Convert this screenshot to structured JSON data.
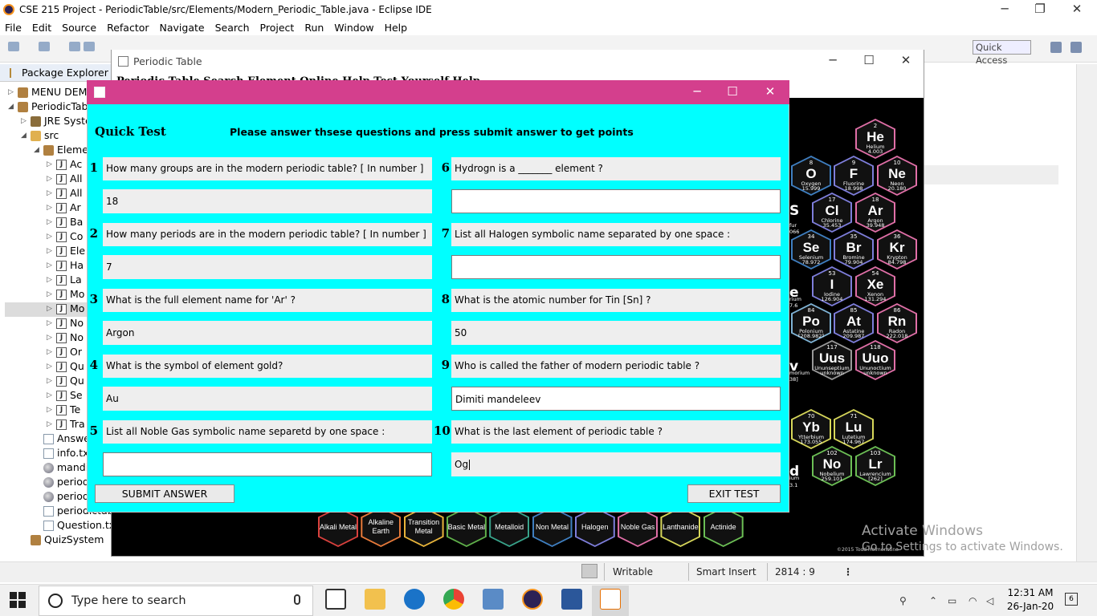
{
  "eclipse": {
    "title": "CSE 215 Project - PeriodicTable/src/Elements/Modern_Periodic_Table.java - Eclipse IDE",
    "menu": [
      "File",
      "Edit",
      "Source",
      "Refactor",
      "Navigate",
      "Search",
      "Project",
      "Run",
      "Window",
      "Help"
    ],
    "quick_access": "Quick Access",
    "package_explorer_tab": "Package Explorer",
    "tree": [
      {
        "label": "MENU DEM",
        "icon": "project-icon",
        "arrow": "▷"
      },
      {
        "label": "PeriodicTab",
        "icon": "project-icon",
        "arrow": "◢"
      },
      {
        "label": "JRE Syste",
        "icon": "library-icon",
        "arrow": "▷"
      },
      {
        "label": "src",
        "icon": "folder-icon",
        "arrow": "◢"
      },
      {
        "label": "Eleme",
        "icon": "package-icon",
        "arrow": "◢"
      },
      {
        "label": "Ac",
        "icon": "java-file-icon",
        "arrow": "▷"
      },
      {
        "label": "All",
        "icon": "java-file-icon",
        "arrow": "▷"
      },
      {
        "label": "All",
        "icon": "java-file-icon",
        "arrow": "▷"
      },
      {
        "label": "Ar",
        "icon": "java-file-icon",
        "arrow": "▷"
      },
      {
        "label": "Ba",
        "icon": "java-file-icon",
        "arrow": "▷"
      },
      {
        "label": "Co",
        "icon": "java-file-icon",
        "arrow": "▷"
      },
      {
        "label": "Ele",
        "icon": "java-file-icon",
        "arrow": "▷"
      },
      {
        "label": "Ha",
        "icon": "java-file-icon",
        "arrow": "▷"
      },
      {
        "label": "La",
        "icon": "java-file-icon",
        "arrow": "▷"
      },
      {
        "label": "Mo",
        "icon": "java-file-icon",
        "arrow": "▷"
      },
      {
        "label": "Mo",
        "icon": "java-file-icon",
        "arrow": "▷"
      },
      {
        "label": "No",
        "icon": "java-file-icon",
        "arrow": "▷"
      },
      {
        "label": "No",
        "icon": "java-file-icon",
        "arrow": "▷"
      },
      {
        "label": "Or",
        "icon": "java-file-icon",
        "arrow": "▷"
      },
      {
        "label": "Qu",
        "icon": "java-file-icon",
        "arrow": "▷"
      },
      {
        "label": "Qu",
        "icon": "java-file-icon",
        "arrow": "▷"
      },
      {
        "label": "Se",
        "icon": "java-file-icon",
        "arrow": "▷"
      },
      {
        "label": "Te",
        "icon": "java-file-icon",
        "arrow": "▷"
      },
      {
        "label": "Tra",
        "icon": "java-file-icon",
        "arrow": "▷"
      },
      {
        "label": "Answers",
        "icon": "text-file-icon",
        "arrow": ""
      },
      {
        "label": "info.txt",
        "icon": "text-file-icon",
        "arrow": ""
      },
      {
        "label": "mandiliv",
        "icon": "image-file-icon",
        "arrow": ""
      },
      {
        "label": "periodic_",
        "icon": "image-file-icon",
        "arrow": ""
      },
      {
        "label": "periodicT",
        "icon": "image-file-icon",
        "arrow": ""
      },
      {
        "label": "periodictable.t",
        "icon": "text-file-icon",
        "arrow": ""
      },
      {
        "label": "Question.txt",
        "icon": "text-file-icon",
        "arrow": ""
      },
      {
        "label": "QuizSystem",
        "icon": "project-icon",
        "arrow": ""
      }
    ],
    "status": {
      "writable": "Writable",
      "insert": "Smart Insert",
      "position": "2814 : 9"
    },
    "activate_line1": "Activate Windows",
    "activate_line2": "Go to Settings to activate Windows."
  },
  "periodic_window": {
    "title": "Periodic Table",
    "menu_text": "Periodic Table  Search Element  Online Help  Test Yourself  Help",
    "copyright": "©2015 Todd Helmenstine",
    "elements": [
      {
        "num": "2",
        "sym": "He",
        "name": "Helium",
        "wt": "4.003",
        "color": "#e06fa7"
      },
      {
        "num": "8",
        "sym": "O",
        "name": "Oxygen",
        "wt": "15.999",
        "color": "#3f7fc1"
      },
      {
        "num": "9",
        "sym": "F",
        "name": "Fluorine",
        "wt": "18.998",
        "color": "#7e7edb"
      },
      {
        "num": "10",
        "sym": "Ne",
        "name": "Neon",
        "wt": "20.180",
        "color": "#e06fa7"
      },
      {
        "num": "17",
        "sym": "Cl",
        "name": "Chlorine",
        "wt": "35.453",
        "color": "#7e7edb"
      },
      {
        "num": "18",
        "sym": "Ar",
        "name": "Argon",
        "wt": "39.948",
        "color": "#e06fa7"
      },
      {
        "num": "34",
        "sym": "Se",
        "name": "Selenium",
        "wt": "78.972",
        "color": "#3f7fc1"
      },
      {
        "num": "35",
        "sym": "Br",
        "name": "Bromine",
        "wt": "79.904",
        "color": "#7e7edb"
      },
      {
        "num": "36",
        "sym": "Kr",
        "name": "Krypton",
        "wt": "84.798",
        "color": "#e06fa7"
      },
      {
        "num": "53",
        "sym": "I",
        "name": "Iodine",
        "wt": "126.904",
        "color": "#7e7edb"
      },
      {
        "num": "54",
        "sym": "Xe",
        "name": "Xenon",
        "wt": "131.294",
        "color": "#e06fa7"
      },
      {
        "num": "84",
        "sym": "Po",
        "name": "Polonium",
        "wt": "[208.982]",
        "color": "#7fb3d5"
      },
      {
        "num": "85",
        "sym": "At",
        "name": "Astatine",
        "wt": "209.987",
        "color": "#7e7edb"
      },
      {
        "num": "86",
        "sym": "Rn",
        "name": "Radon",
        "wt": "222.018",
        "color": "#e06fa7"
      },
      {
        "num": "117",
        "sym": "Uus",
        "name": "Ununseptium",
        "wt": "unknown",
        "color": "#999999"
      },
      {
        "num": "118",
        "sym": "Uuo",
        "name": "Ununoctium",
        "wt": "unknown",
        "color": "#e06fa7"
      },
      {
        "num": "70",
        "sym": "Yb",
        "name": "Ytterbium",
        "wt": "173.055",
        "color": "#d7d75a"
      },
      {
        "num": "71",
        "sym": "Lu",
        "name": "Lutetium",
        "wt": "174.967",
        "color": "#d7d75a"
      },
      {
        "num": "102",
        "sym": "No",
        "name": "Nobelium",
        "wt": "259.101",
        "color": "#6cbf55"
      },
      {
        "num": "103",
        "sym": "Lr",
        "name": "Lawrencium",
        "wt": "[262]",
        "color": "#6cbf55"
      }
    ],
    "partial_elements": [
      "S",
      "e",
      "v",
      "d"
    ],
    "partial_labels": [
      "fur",
      "066",
      "rium",
      "7.6",
      "morium",
      "38]",
      "ium",
      "3.1"
    ],
    "categories": [
      {
        "label": "Alkali Metal",
        "color": "#d9413d"
      },
      {
        "label": "Alkaline Earth",
        "color": "#e87a3a"
      },
      {
        "label": "Transition Metal",
        "color": "#e8b43a"
      },
      {
        "label": "Basic Metal",
        "color": "#5fb04a"
      },
      {
        "label": "Metalloid",
        "color": "#38a38a"
      },
      {
        "label": "Non Metal",
        "color": "#3f7fc1"
      },
      {
        "label": "Halogen",
        "color": "#7e7edb"
      },
      {
        "label": "Noble Gas",
        "color": "#e06fa7"
      },
      {
        "label": "Lanthanide",
        "color": "#d7d75a"
      },
      {
        "label": "Actinide",
        "color": "#6cbf55"
      }
    ]
  },
  "quiz": {
    "heading": "Quick Test",
    "instruction": "Please answer thsese questions and press submit answer to get points",
    "questions": [
      {
        "n": "1",
        "q": "How many groups are in the modern periodic table? [ In number ]",
        "a": "18",
        "editable": false
      },
      {
        "n": "2",
        "q": "How many periods are in the modern periodic table? [ In number ]",
        "a": "7",
        "editable": false
      },
      {
        "n": "3",
        "q": "What is the full element name for 'Ar' ?",
        "a": "Argon",
        "editable": false
      },
      {
        "n": "4",
        "q": "What is the symbol of element gold?",
        "a": "Au",
        "editable": false
      },
      {
        "n": "5",
        "q": "List all Noble Gas symbolic name separetd by one space :",
        "a": "",
        "editable": true
      },
      {
        "n": "6",
        "q": "Hydrogn is a _______ element ?",
        "a": "",
        "editable": true
      },
      {
        "n": "7",
        "q": "List all Halogen symbolic name separated by one space :",
        "a": "",
        "editable": true
      },
      {
        "n": "8",
        "q": "What is the atomic number for Tin [Sn] ?",
        "a": "50",
        "editable": false
      },
      {
        "n": "9",
        "q": "Who is called the father of modern periodic table ?",
        "a": "Dimiti mandeleev",
        "editable": true
      },
      {
        "n": "10",
        "q": "What is the last element of periodic table ?",
        "a": "Og",
        "editable": false
      }
    ],
    "submit": "SUBMIT ANSWER",
    "exit": "EXIT TEST"
  },
  "taskbar": {
    "search_placeholder": "Type here to search",
    "time": "12:31 AM",
    "date": "26-Jan-20",
    "notifications": "6"
  }
}
